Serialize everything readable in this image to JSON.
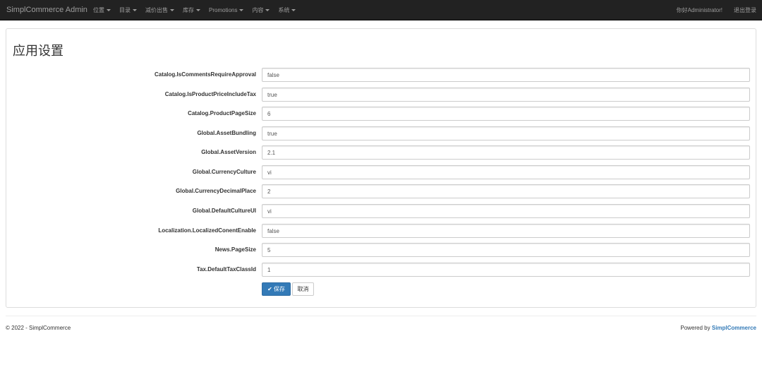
{
  "navbar": {
    "brand": "SimplCommerce Admin",
    "menu": [
      {
        "label": "位置"
      },
      {
        "label": "目录"
      },
      {
        "label": "减价出售"
      },
      {
        "label": "库存"
      },
      {
        "label": "Promotions"
      },
      {
        "label": "内容"
      },
      {
        "label": "系统"
      }
    ],
    "greeting": "你好Administrator!",
    "logout": "退出登录"
  },
  "page": {
    "title": "应用设置"
  },
  "settings": [
    {
      "key": "Catalog.IsCommentsRequireApproval",
      "value": "false"
    },
    {
      "key": "Catalog.IsProductPriceIncludeTax",
      "value": "true"
    },
    {
      "key": "Catalog.ProductPageSize",
      "value": "6"
    },
    {
      "key": "Global.AssetBundling",
      "value": "true"
    },
    {
      "key": "Global.AssetVersion",
      "value": "2.1"
    },
    {
      "key": "Global.CurrencyCulture",
      "value": "vi"
    },
    {
      "key": "Global.CurrencyDecimalPlace",
      "value": "2"
    },
    {
      "key": "Global.DefaultCultureUI",
      "value": "vi"
    },
    {
      "key": "Localization.LocalizedConentEnable",
      "value": "false"
    },
    {
      "key": "News.PageSize",
      "value": "5"
    },
    {
      "key": "Tax.DefaultTaxClassId",
      "value": "1"
    }
  ],
  "actions": {
    "save": "保存",
    "cancel": "取消"
  },
  "footer": {
    "copyright": "© 2022 - SimplCommerce",
    "powered_by": "Powered by",
    "link": "SimplCommerce"
  },
  "colors": {
    "navbar_bg": "#222222",
    "primary": "#337ab7"
  }
}
